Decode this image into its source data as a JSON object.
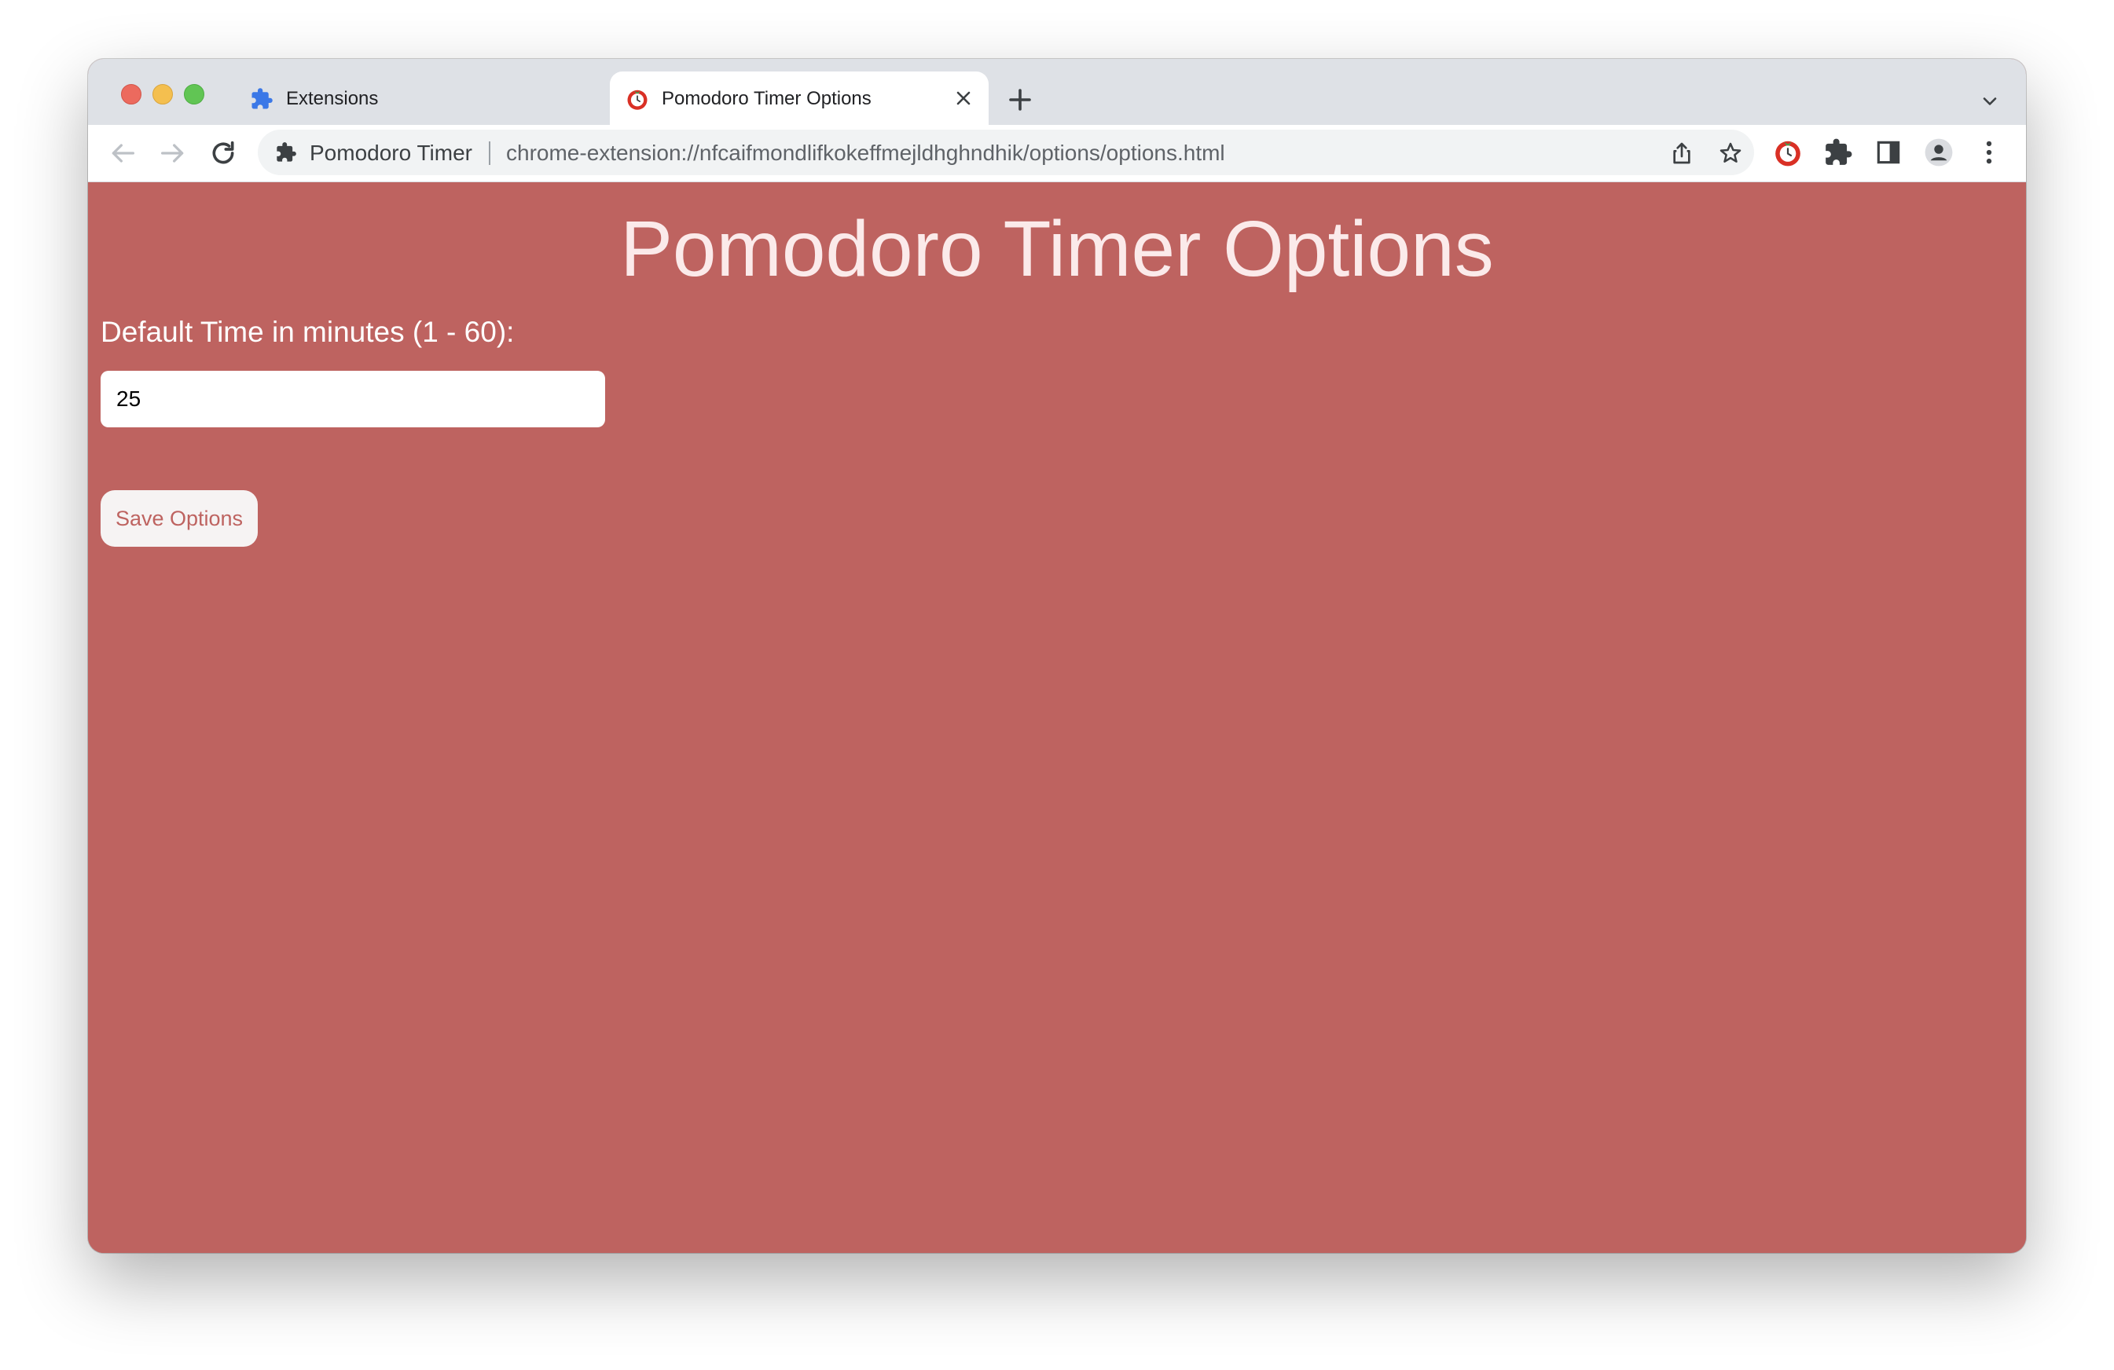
{
  "browser": {
    "tabs": [
      {
        "title": "Extensions",
        "icon": "puzzle-icon",
        "active": false
      },
      {
        "title": "Pomodoro Timer Options",
        "icon": "tomato-timer-icon",
        "active": true
      }
    ],
    "address_bar": {
      "site_name": "Pomodoro Timer",
      "url": "chrome-extension://nfcaifmondlifkokeffmejldhghndhik/options/options.html"
    }
  },
  "page": {
    "title": "Pomodoro Timer Options",
    "time_label": "Default Time in minutes (1 - 60):",
    "time_value": "25",
    "save_label": "Save Options"
  },
  "colors": {
    "page_background": "#be6360",
    "tab_bar": "#dee1e6",
    "accent": "#be6360"
  }
}
